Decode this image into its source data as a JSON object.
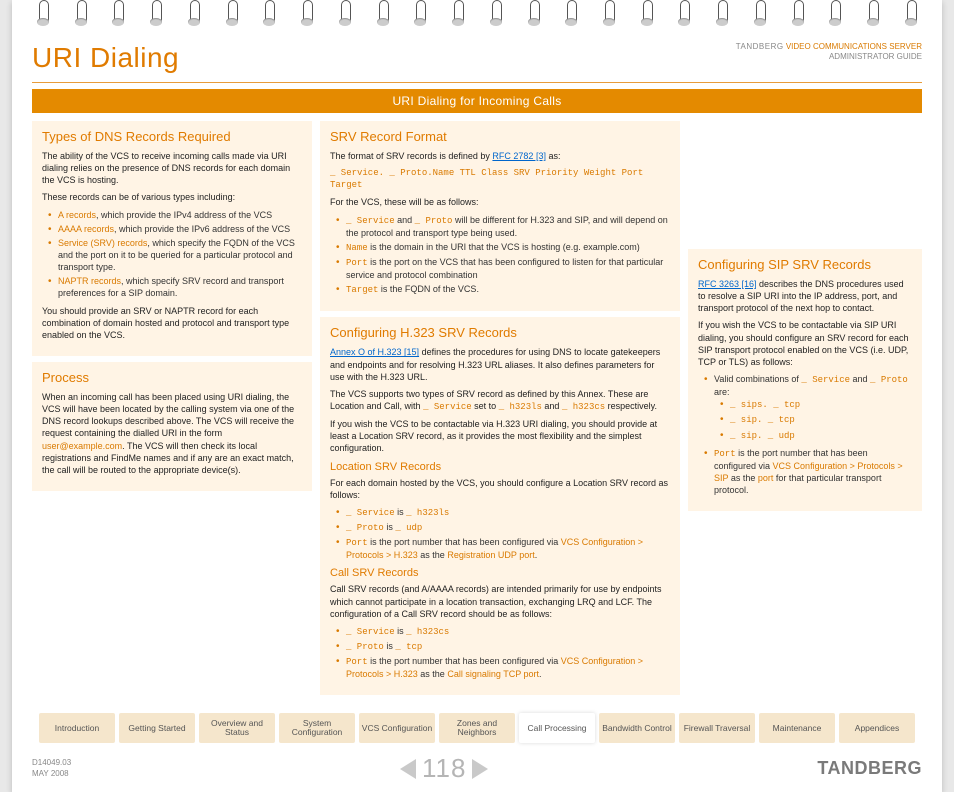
{
  "header": {
    "title": "URI Dialing",
    "brand": "TANDBERG",
    "product": "VIDEO COMMUNICATIONS SERVER",
    "guide": "ADMINISTRATOR GUIDE"
  },
  "bar": "URI Dialing for Incoming Calls",
  "col1": {
    "s1_title": "Types of DNS Records Required",
    "s1_p1": "The ability of the VCS to receive incoming calls made via URI dialing relies on the presence of DNS records for each domain the VCS is hosting.",
    "s1_p2": "These records can be of various types including:",
    "s1_b1a": "A records",
    "s1_b1b": ", which provide the IPv4 address of the VCS",
    "s1_b2a": "AAAA records",
    "s1_b2b": ", which provide the IPv6 address of the VCS",
    "s1_b3a": "Service (SRV) records",
    "s1_b3b": ", which specify the FQDN of the VCS and the port on it to be queried for a particular protocol and transport type.",
    "s1_b4a": "NAPTR records",
    "s1_b4b": ", which specify SRV record and transport preferences for a SIP domain.",
    "s1_p3": "You should provide an SRV or NAPTR record for each combination of domain hosted and protocol and transport type enabled on the VCS.",
    "s2_title": "Process",
    "s2_p1a": "When an incoming call has been placed using URI dialing, the VCS will have been located by the calling system via one of the DNS record lookups described above.  The VCS will receive the request containing the dialled URI in the form ",
    "s2_p1b": "user@example.com",
    "s2_p1c": ".  The VCS will then check its local registrations and FindMe names and if any are an exact match, the call will be routed to the appropriate device(s)."
  },
  "col2": {
    "s1_title": "SRV Record Format",
    "s1_p1a": "The format of SRV records is defined by ",
    "s1_link1": "RFC 2782 [3]",
    "s1_p1b": " as:",
    "s1_code": "_ Service. _ Proto.Name TTL Class SRV Priority Weight Port Target",
    "s1_p2": "For the VCS, these will be as follows:",
    "s1_b1a": "_ Service",
    "s1_b1b": " and ",
    "s1_b1c": "_ Proto",
    "s1_b1d": " will be different for H.323 and SIP, and will depend on the protocol and transport type being used.",
    "s1_b2a": "Name",
    "s1_b2b": " is the domain in the URI that the VCS is hosting (e.g. example.com)",
    "s1_b3a": "Port",
    "s1_b3b": " is the port on the VCS that has been configured to listen for that particular service and protocol combination",
    "s1_b4a": "Target",
    "s1_b4b": " is the FQDN of the VCS.",
    "s2_title": "Configuring H.323 SRV Records",
    "s2_p1a": "Annex O of H.323 [15]",
    "s2_p1b": " defines the procedures for using DNS to locate gatekeepers and endpoints and for resolving H.323 URL aliases. It also defines parameters for use with the H.323 URL.",
    "s2_p2a": "The VCS supports two types of SRV record as defined by this Annex.  These are Location and Call, with ",
    "s2_p2b": "_ Service",
    "s2_p2c": " set to ",
    "s2_p2d": "_ h323ls",
    "s2_p2e": " and ",
    "s2_p2f": "_ h323cs",
    "s2_p2g": " respectively.",
    "s2_p3": "If you wish the VCS to be contactable via H.323 URI dialing, you should provide at least a Location SRV record, as it provides the most flexibility and the simplest configuration.",
    "loc_title": "Location SRV Records",
    "loc_p1": "For each domain hosted by the VCS, you should configure a Location SRV record as follows:",
    "loc_b1a": "_ Service",
    "loc_b1b": " is ",
    "loc_b1c": "_ h323ls",
    "loc_b2a": "_ Proto",
    "loc_b2b": " is ",
    "loc_b2c": "_ udp",
    "loc_b3a": "Port",
    "loc_b3b": " is the port number that has been configured via ",
    "loc_b3c": "VCS Configuration > Protocols > H.323",
    "loc_b3d": " as the ",
    "loc_b3e": "Registration UDP port",
    "loc_b3f": ".",
    "call_title": "Call SRV Records",
    "call_p1": "Call SRV records (and A/AAAA records) are intended primarily for use by endpoints which cannot participate in a location transaction, exchanging LRQ and LCF.  The configuration of a Call SRV record should be as follows:",
    "call_b1a": "_ Service",
    "call_b1b": " is ",
    "call_b1c": "_ h323cs",
    "call_b2a": "_ Proto",
    "call_b2b": " is ",
    "call_b2c": "_ tcp",
    "call_b3a": "Port",
    "call_b3b": " is the port number that has been configured via ",
    "call_b3c": "VCS Configuration > Protocols > H.323",
    "call_b3d": " as the ",
    "call_b3e": "Call signaling TCP port",
    "call_b3f": "."
  },
  "col3": {
    "s1_title": "Configuring SIP SRV Records",
    "s1_p1a": "RFC 3263 [16]",
    "s1_p1b": " describes the DNS procedures used to resolve a SIP URI into the IP address, port, and transport protocol of the next hop to contact.",
    "s1_p2": "If you wish the VCS to be contactable via SIP URI dialing, you should configure an SRV record for each SIP transport protocol enabled on the VCS (i.e. UDP, TCP or TLS) as follows:",
    "b1a": "Valid combinations of ",
    "b1b": "_ Service",
    "b1c": " and ",
    "b1d": "_ Proto",
    "b1e": " are:",
    "sub1": "_ sips. _ tcp",
    "sub2": "_ sip. _ tcp",
    "sub3": "_ sip. _ udp",
    "b2a": "Port",
    "b2b": " is the port number that has been configured via ",
    "b2c": "VCS Configuration > Protocols > SIP",
    "b2d": " as the ",
    "b2e": "port",
    "b2f": " for that particular transport protocol."
  },
  "tabs": [
    "Introduction",
    "Getting Started",
    "Overview and Status",
    "System Configuration",
    "VCS Configuration",
    "Zones and Neighbors",
    "Call Processing",
    "Bandwidth Control",
    "Firewall Traversal",
    "Maintenance",
    "Appendices"
  ],
  "active_tab": 6,
  "footer": {
    "doc": "D14049.03",
    "date": "MAY 2008",
    "page": "118",
    "brand": "TANDBERG"
  }
}
